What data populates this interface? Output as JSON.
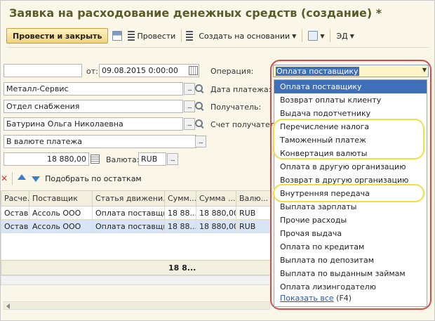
{
  "window": {
    "title": "Заявка на расходование денежных средств (создание) *"
  },
  "toolbar": {
    "post_close_label": "Провести и закрыть",
    "post_label": "Провести",
    "create_basis_label": "Создать на основании",
    "ed_label": "ЭД"
  },
  "form": {
    "number_value": "",
    "date_label": "от:",
    "date_value": "09.08.2015 0:00:00",
    "operation_label": "Операция:",
    "payment_date_label": "Дата платежа:",
    "recipient_label": "Получатель:",
    "recipient_account_label": "Счет получателя",
    "counterparty_value": "Металл-Сервис",
    "department_value": "Отдел снабжения",
    "responsible_value": "Батурина Ольга Николаевна",
    "payment_type_value": "В валюте платежа",
    "amount_value": "18 880,00",
    "currency_label": "Валюта:",
    "currency_value": "RUB"
  },
  "grid_toolbar": {
    "pick_label": "Подобрать по остаткам"
  },
  "grid": {
    "columns": [
      "Расче...",
      "Поставщик",
      "Статья движени...",
      "Сумм...",
      "Сумма ...",
      "Валю..."
    ],
    "rows": [
      [
        "Оставка",
        "Ассоль ООО",
        "Оплата поставщиц",
        "18 88...",
        "18 880,00",
        "RUB"
      ],
      [
        "Оставка",
        "Ассоль ООО",
        "Оплата поставщиц",
        "18 88...",
        "18 880,00",
        "RUB"
      ]
    ],
    "footer_total": "18 8..."
  },
  "operation": {
    "selected": "Оплата поставщику",
    "options": [
      "Оплата поставщику",
      "Возврат оплаты клиенту",
      "Выдача подотчетнику",
      "Перечисление налога",
      "Таможенный платеж",
      "Конвертация валюты",
      "Оплата в другую организацию",
      "Возврат в другую организацию",
      "Внутренняя передача",
      "Выплата зарплаты",
      "Прочие расходы",
      "Прочая выдача",
      "Оплата по кредитам",
      "Выплата по депозитам",
      "Выплата по выданным займам",
      "Оплата лизингодателю"
    ],
    "show_all_label": "Показать все",
    "show_all_key": "(F4)"
  },
  "colors": {
    "highlight_red": "#d64b4b",
    "highlight_yellow": "#f2de47",
    "selection": "#3f6fb8"
  }
}
